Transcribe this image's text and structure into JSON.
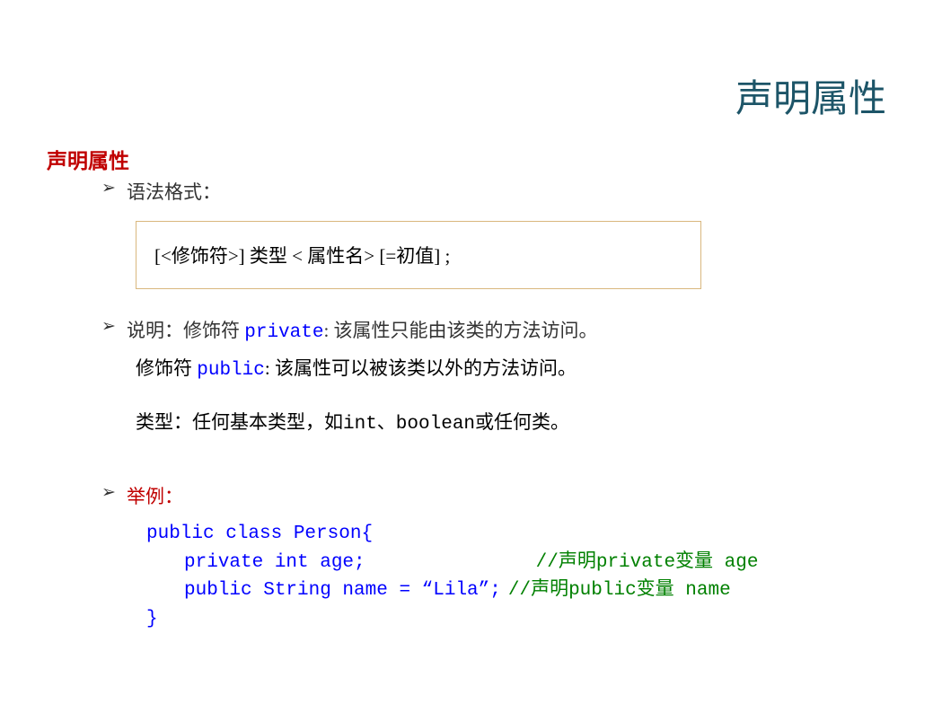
{
  "title": "声明属性",
  "section_title": "声明属性",
  "bullet1": "语法格式：",
  "syntax": "[<修饰符>]  类型  < 属性名> [=初值] ;",
  "bullet2_prefix": "说明：修饰符 ",
  "bullet2_private": "private",
  "bullet2_suffix": ": 该属性只能由该类的方法访问。",
  "desc2_prefix": "修饰符 ",
  "desc2_public": "public",
  "desc2_suffix": ": 该属性可以被该类以外的方法访问。",
  "desc3_prefix": "类型：任何基本类型，如",
  "desc3_types": "int、boolean",
  "desc3_suffix": "或任何类。",
  "bullet3": "举例：",
  "code_line1": "public class Person{",
  "code_line2a": "private int age;",
  "code_line2b": "//声明private变量 age",
  "code_line3a": "public String name = “Lila”;",
  "code_line3b": "//声明public变量 name",
  "code_line4": "}"
}
